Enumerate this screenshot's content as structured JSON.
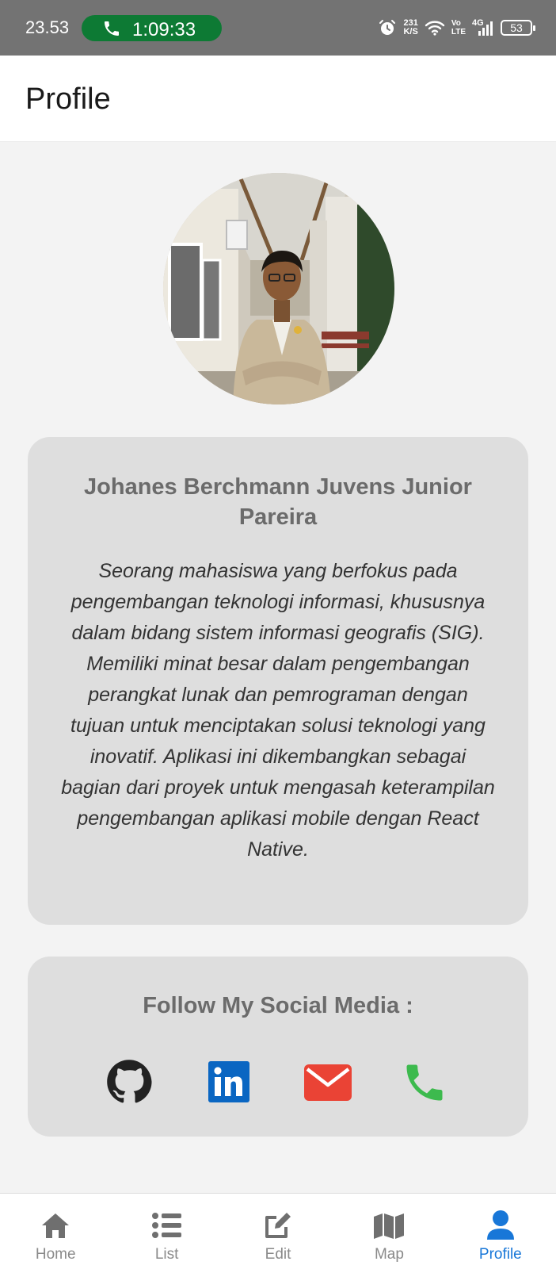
{
  "status_bar": {
    "time": "23.53",
    "call_timer": "1:09:33",
    "net_speed_value": "231",
    "net_speed_unit": "K/S",
    "volte_top": "Vo",
    "volte_bottom": "LTE",
    "network": "4G",
    "battery": "53"
  },
  "header": {
    "title": "Profile"
  },
  "profile": {
    "name": "Johanes Berchmann Juvens Junior Pareira",
    "bio": "Seorang mahasiswa yang berfokus pada pengembangan teknologi informasi, khususnya dalam bidang sistem informasi geografis (SIG). Memiliki minat besar dalam pengembangan perangkat lunak dan pemrograman dengan tujuan untuk menciptakan solusi teknologi yang inovatif. Aplikasi ini dikembangkan sebagai bagian dari proyek untuk mengasah keterampilan pengembangan aplikasi mobile dengan React Native."
  },
  "social": {
    "title": "Follow My Social Media :",
    "links": [
      {
        "icon": "github-icon",
        "color": "#222222"
      },
      {
        "icon": "linkedin-icon",
        "color": "#0a66c2"
      },
      {
        "icon": "email-icon",
        "color": "#ea4335"
      },
      {
        "icon": "phone-icon",
        "color": "#3dba4e"
      }
    ]
  },
  "bottom_nav": {
    "items": [
      {
        "label": "Home",
        "icon": "home-icon"
      },
      {
        "label": "List",
        "icon": "list-icon"
      },
      {
        "label": "Edit",
        "icon": "edit-icon"
      },
      {
        "label": "Map",
        "icon": "map-icon"
      },
      {
        "label": "Profile",
        "icon": "person-icon"
      }
    ],
    "active": "Profile",
    "active_color": "#1877d8",
    "inactive_color": "#6f6f6f"
  }
}
